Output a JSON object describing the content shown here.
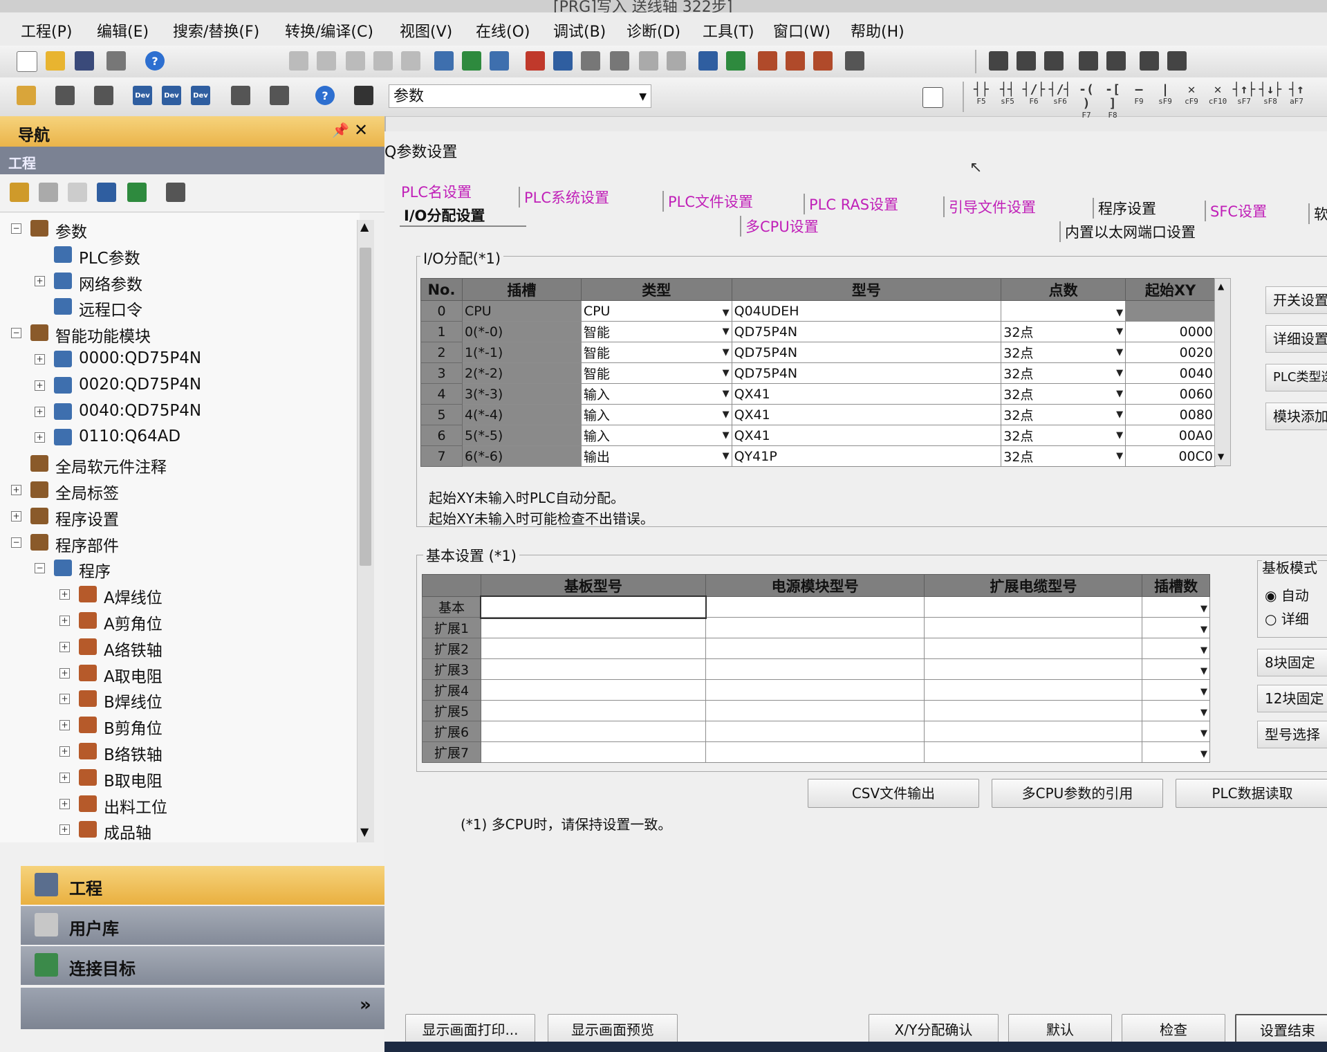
{
  "window_title": "[PRG]写入 送线轴 322步]",
  "menu": [
    "工程(P)",
    "编辑(E)",
    "搜索/替换(F)",
    "转换/编译(C)",
    "视图(V)",
    "在线(O)",
    "调试(B)",
    "诊断(D)",
    "工具(T)",
    "窗口(W)",
    "帮助(H)"
  ],
  "toolbar": {
    "combo_value": "参数"
  },
  "fkeys": [
    {
      "sym": "┤├",
      "label": "F5"
    },
    {
      "sym": "┤┤",
      "label": "sF5"
    },
    {
      "sym": "┤/├",
      "label": "F6"
    },
    {
      "sym": "┤/┤",
      "label": "sF6"
    },
    {
      "sym": "-( )",
      "label": "F7"
    },
    {
      "sym": "-[ ]",
      "label": "F8"
    },
    {
      "sym": "—",
      "label": "F9"
    },
    {
      "sym": "|",
      "label": "sF9"
    },
    {
      "sym": "✕",
      "label": "cF9"
    },
    {
      "sym": "✕",
      "label": "cF10"
    },
    {
      "sym": "┤↑├",
      "label": "sF7"
    },
    {
      "sym": "┤↓├",
      "label": "sF8"
    },
    {
      "sym": "┤↑",
      "label": "aF7"
    }
  ],
  "nav": {
    "title": "导航",
    "section": "工程",
    "tree": [
      {
        "label": "参数",
        "level": 0,
        "exp": "minus"
      },
      {
        "label": "PLC参数",
        "level": 1,
        "exp": ""
      },
      {
        "label": "网络参数",
        "level": 1,
        "exp": "plus"
      },
      {
        "label": "远程口令",
        "level": 1,
        "exp": ""
      },
      {
        "label": "智能功能模块",
        "level": 0,
        "exp": "minus"
      },
      {
        "label": "0000:QD75P4N",
        "level": 1,
        "exp": "plus"
      },
      {
        "label": "0020:QD75P4N",
        "level": 1,
        "exp": "plus"
      },
      {
        "label": "0040:QD75P4N",
        "level": 1,
        "exp": "plus"
      },
      {
        "label": "0110:Q64AD",
        "level": 1,
        "exp": "plus"
      },
      {
        "label": "全局软元件注释",
        "level": 0,
        "exp": ""
      },
      {
        "label": "全局标签",
        "level": 0,
        "exp": "plus"
      },
      {
        "label": "程序设置",
        "level": 0,
        "exp": "plus"
      },
      {
        "label": "程序部件",
        "level": 0,
        "exp": "minus"
      },
      {
        "label": "程序",
        "level": 1,
        "exp": "minus"
      },
      {
        "label": "A焊线位",
        "level": 2,
        "exp": "plus"
      },
      {
        "label": "A剪角位",
        "level": 2,
        "exp": "plus"
      },
      {
        "label": "A络铁轴",
        "level": 2,
        "exp": "plus"
      },
      {
        "label": "A取电阻",
        "level": 2,
        "exp": "plus"
      },
      {
        "label": "B焊线位",
        "level": 2,
        "exp": "plus"
      },
      {
        "label": "B剪角位",
        "level": 2,
        "exp": "plus"
      },
      {
        "label": "B络铁轴",
        "level": 2,
        "exp": "plus"
      },
      {
        "label": "B取电阻",
        "level": 2,
        "exp": "plus"
      },
      {
        "label": "出料工位",
        "level": 2,
        "exp": "plus"
      },
      {
        "label": "成品轴",
        "level": 2,
        "exp": "plus"
      }
    ],
    "bottom_buttons": [
      "工程",
      "用户库",
      "连接目标"
    ],
    "more": "»"
  },
  "dialog": {
    "title": "Q参数设置",
    "tabs_row1": [
      "PLC名设置",
      "PLC系统设置",
      "PLC文件设置",
      "PLC RAS设置",
      "引导文件设置",
      "程序设置",
      "SFC设置",
      "软"
    ],
    "tabs_row2": [
      "I/O分配设置",
      "多CPU设置",
      "内置以太网端口设置"
    ],
    "io": {
      "group_title": "I/O分配(*1)",
      "headers": [
        "No.",
        "插槽",
        "类型",
        "型号",
        "点数",
        "起始XY"
      ],
      "rows": [
        {
          "no": "0",
          "slot": "CPU",
          "type": "CPU",
          "model": "Q04UDEH",
          "points": "",
          "start": ""
        },
        {
          "no": "1",
          "slot": "0(*-0)",
          "type": "智能",
          "model": "QD75P4N",
          "points": "32点",
          "start": "0000"
        },
        {
          "no": "2",
          "slot": "1(*-1)",
          "type": "智能",
          "model": "QD75P4N",
          "points": "32点",
          "start": "0020"
        },
        {
          "no": "3",
          "slot": "2(*-2)",
          "type": "智能",
          "model": "QD75P4N",
          "points": "32点",
          "start": "0040"
        },
        {
          "no": "4",
          "slot": "3(*-3)",
          "type": "输入",
          "model": "QX41",
          "points": "32点",
          "start": "0060"
        },
        {
          "no": "5",
          "slot": "4(*-4)",
          "type": "输入",
          "model": "QX41",
          "points": "32点",
          "start": "0080"
        },
        {
          "no": "6",
          "slot": "5(*-5)",
          "type": "输入",
          "model": "QX41",
          "points": "32点",
          "start": "00A0"
        },
        {
          "no": "7",
          "slot": "6(*-6)",
          "type": "输出",
          "model": "QY41P",
          "points": "32点",
          "start": "00C0"
        }
      ],
      "note1": "起始XY未输入时PLC自动分配。",
      "note2": "起始XY未输入时可能检查不出错误。",
      "side_buttons": [
        "开关设置",
        "详细设置",
        "PLC类型选择",
        "模块添加"
      ]
    },
    "base": {
      "group_title": "基本设置 (*1)",
      "headers": [
        "",
        "基板型号",
        "电源模块型号",
        "扩展电缆型号",
        "插槽数"
      ],
      "rows": [
        "基本",
        "扩展1",
        "扩展2",
        "扩展3",
        "扩展4",
        "扩展5",
        "扩展6",
        "扩展7"
      ],
      "mode_title": "基板模式",
      "mode_options": [
        "自动",
        "详细"
      ],
      "mode_selected": "自动",
      "side_buttons": [
        "8块固定",
        "12块固定",
        "型号选择"
      ]
    },
    "action_buttons": [
      "CSV文件输出",
      "多CPU参数的引用",
      "PLC数据读取"
    ],
    "footnote": "(*1) 多CPU时，请保持设置一致。",
    "footer_buttons": [
      "显示画面打印...",
      "显示画面预览",
      "X/Y分配确认",
      "默认",
      "检查",
      "设置结束"
    ]
  },
  "colors": {
    "nav_header": "#eab44a",
    "pink_tab": "#c020b8",
    "grid_header": "#7f7f7f",
    "taskbar": "#1d2a42"
  }
}
